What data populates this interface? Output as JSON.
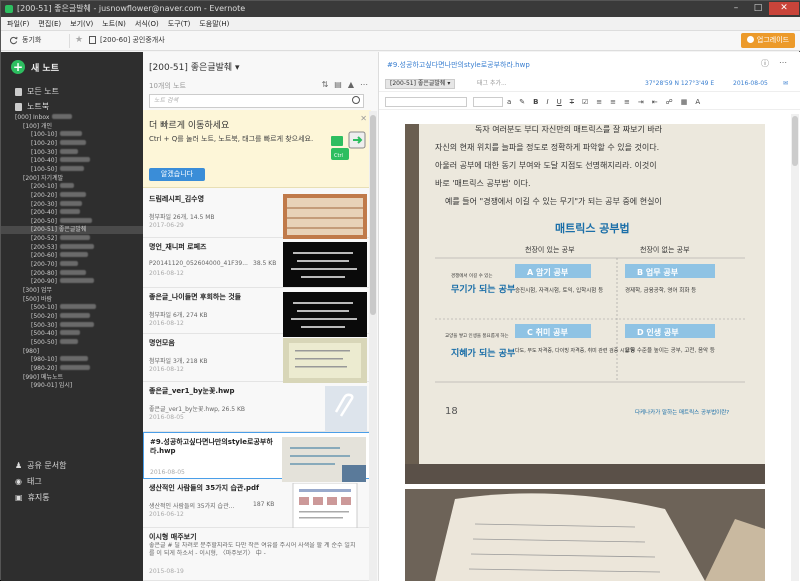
{
  "titlebar": {
    "title": "[200-51] 좋은글발췌 - jusnowflower@naver.com - Evernote"
  },
  "menu": [
    "파일(F)",
    "편집(E)",
    "보기(V)",
    "노트(N)",
    "서식(O)",
    "도구(T)",
    "도움말(H)"
  ],
  "toolbar": {
    "sync": "동기화",
    "shortcut": "[200-60] 공인중개사",
    "upgrade": "업그레이드"
  },
  "sidebar": {
    "new_note": "새 노트",
    "all_notes": "모든 노트",
    "notebooks": "노트북",
    "tree": [
      "[000] Inbox",
      "[100] 개인",
      "[100-10]",
      "[100-20]",
      "[100-30]",
      "[100-40]",
      "[100-50]",
      "[200] 자기계발",
      "[200-10]",
      "[200-20]",
      "[200-30]",
      "[200-40]",
      "[200-50]",
      "[200-51] 좋은글발췌",
      "[200-52]",
      "[200-53]",
      "[200-60]",
      "[200-70]",
      "[200-80]",
      "[200-90]",
      "[300] 업무",
      "[500] 바람",
      "[500-10]",
      "[500-20]",
      "[500-30]",
      "[500-40]",
      "[500-50]",
      "[980]",
      "[980-10]",
      "[980-20]",
      "[990] 메뉴노트",
      "[990-01] 임시]"
    ],
    "shared": "공유 문서함",
    "tags": "태그",
    "trash": "휴지통"
  },
  "notelist": {
    "title": "[200-51] 좋은글발췌",
    "count": "10개의 노트",
    "search_placeholder": "노트 검색",
    "tip": {
      "heading": "더 빠르게 이동하세요",
      "body": "Ctrl + Q를 눌러 노트, 노트북, 태그를 빠르게 찾으세요.",
      "button": "알겠습니다",
      "key": "Ctrl"
    },
    "notes": [
      {
        "title": "드림레시피_김수영",
        "snippet": "첨부파일 26개, 14.5 MB",
        "size": "",
        "date": "2017-06-29"
      },
      {
        "title": "명언_재니퍼 로페즈",
        "snippet": "P20141120_052604000_41F39...",
        "size": "38.5 KB",
        "date": "2016-08-12"
      },
      {
        "title": "좋은글_나이들면 후회하는 것들",
        "snippet": "첨부파일 6개, 274 KB",
        "size": "",
        "date": "2016-08-12"
      },
      {
        "title": "명언모음",
        "snippet": "첨부파일 3개, 218 KB",
        "size": "",
        "date": "2016-08-12"
      },
      {
        "title": "좋은글_ver1_by눈꽃.hwp",
        "snippet": "좋은글_ver1_by눈꽃.hwp, 26.5 KB",
        "size": "",
        "date": "2016-08-05"
      },
      {
        "title": "#9.성공하고싶다면나만의style로공부하라.hwp",
        "snippet": "",
        "size": "",
        "date": "2016-08-05"
      },
      {
        "title": "생산적인 사람들의 35가지 습관.pdf",
        "snippet": "생산적인 사람들의 35가지 습관...",
        "size": "187 KB",
        "date": "2016-06-12"
      },
      {
        "title": "이시형 매주보기",
        "snippet": "좋은글 # 딜 차려로 분주할지라도 다만 작은 여유를 주시어 사색을 할 계 순수 일치를 이 되게 하소서 - 이시형, 〈마주보기〉 中 -",
        "size": "",
        "date": "2015-08-19"
      }
    ]
  },
  "editor": {
    "title": "#9.성공하고싶다면나만의style로공부하라.hwp",
    "notebook": "[200-51] 좋은글발췌",
    "tag_placeholder": "태그 추가...",
    "location": "37°28'59 N  127°3'49 E",
    "date": "2016-08-05",
    "book": {
      "line1": "독자 여러분도 부디 자신만의 매트릭스를 잘 짜보기 바라",
      "line2": "자신의 현재 위치를 늘파을 정도로 정확하게 파악할 수 있을 것이다.",
      "line3": "아울러 공부에 대한 동기 부여와 도달 지점도 선명해지리라. 이것이",
      "line4": "바로 '매트릭스 공부법' 이다.",
      "line5": "예를 들어 \"경쟁에서 이길 수 있는 무기\"가 되는 공부 중에 현실이",
      "heading": "매트릭스 공부법",
      "col1": "천장이 있는 공부",
      "col2": "천장이 없는 공부",
      "row1": "무기가 되는 공부",
      "row1_small": "경쟁에서 이길 수 있는",
      "row2": "지혜가 되는 공부",
      "row2_small": "교양을 쌓고 인생을 풍요롭게 하는",
      "cellA": "A 암기 공부",
      "cellA_desc": "승진시험, 자격시험, 토익, 입학시험 등",
      "cellB": "B 업무 공부",
      "cellB_desc": "경제학, 금융공학, 영어 회화 등",
      "cellC": "C 취미 공부",
      "cellC_desc": "다도, 무도 자격증, 다이빙 자격증, 취미 관련 검증 시험 등",
      "cellD": "D 인생 공부",
      "cellD_desc": "교양 수준을 높이는 공부, 고전, 음악 등",
      "page": "18",
      "footer": "다케나카가 말하는 매트릭스 공부법이란?"
    }
  }
}
